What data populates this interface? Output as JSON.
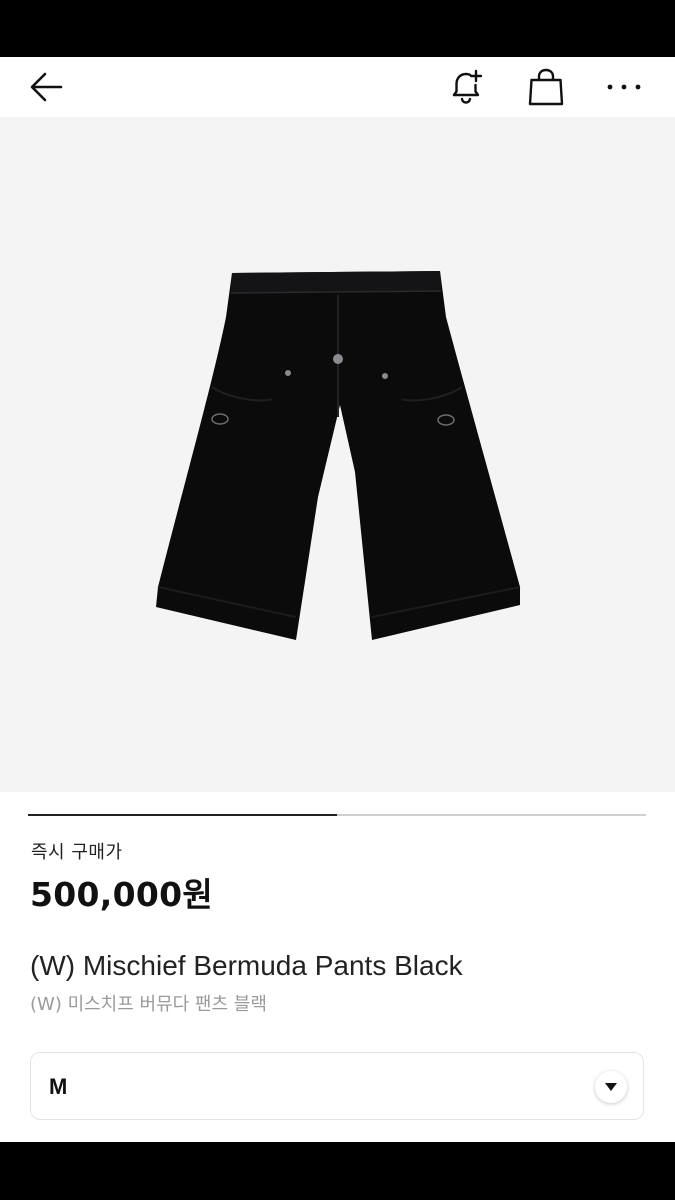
{
  "header": {
    "icons": [
      "arrow-left-icon",
      "bell-plus-icon",
      "shopping-bag-icon",
      "more-horizontal-icon"
    ]
  },
  "gallery": {
    "image": "black bermuda shorts",
    "pager_progress": 0.5
  },
  "product": {
    "price_label": "즉시 구매가",
    "price": "500,000원",
    "name_en": "(W) Mischief Bermuda Pants Black",
    "name_ko": "(W) 미스치프 버뮤다 팬츠 블랙"
  },
  "size_select": {
    "value": "M",
    "icon": "chevron-down-icon"
  },
  "colors": {
    "image_bg": "#f4f4f4",
    "pager_active": "#222222",
    "pager_track": "#cfcfcf"
  }
}
